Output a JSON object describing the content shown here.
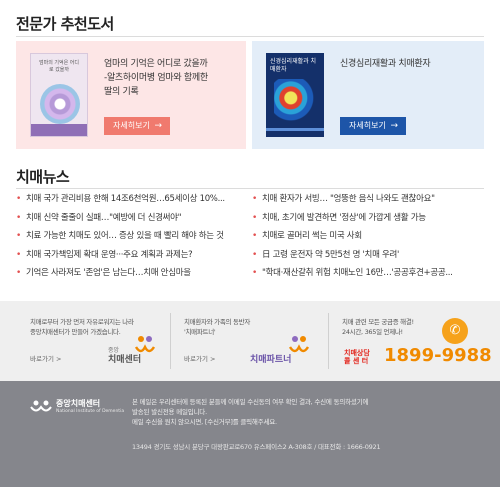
{
  "books": {
    "title": "전문가 추천도서",
    "items": [
      {
        "cover_text": "엄마의 기억은 어디로 갔을까",
        "text_line1": "엄마의 기억은 어디로 갔을까",
        "text_line2": "-알츠하이머병 엄마와 함께한",
        "text_line3": "딸의 기록",
        "button": "자세히보기"
      },
      {
        "cover_text": "신경심리재활과 치매환자",
        "text_line1": "신경심리재활과 치매환자",
        "button": "자세히보기"
      }
    ]
  },
  "news": {
    "title": "치매뉴스",
    "left": [
      "치매 국가 관리비용 한해 14조6천억원…65세이상 10%...",
      "치매 신약 줄줄이 실패…\"예방에 더 신경써야\"",
      "치료 가능한 치매도 있어… 증상 있을 때 빨리 해야 하는 것",
      "치매 국가책임제 확대 운영···주요 계획과 과제는?",
      "기억은 사라져도 '존엄'은 남는다…치매 안심마을"
    ],
    "right": [
      "치매 환자가 서빙… \"엉뚱한 음식 나와도 괜찮아요\"",
      "치매, 초기에 발견하면 '정상'에 가깝게 생활 가능",
      "치매로 골머리 썩는 미국 사회",
      "日 고령 운전자 약 5만5천 명 '치매 우려'",
      "\"학대·재산갈취 위험 치매노인 16만…'공공후견+공공..."
    ]
  },
  "promo": {
    "col1": {
      "desc1": "치매로부터 가장 먼저 자유로워지는 나라",
      "desc2": "중앙치매센터가 만들어 가겠습니다.",
      "more": "바로가기 >",
      "logo_small": "중앙",
      "logo": "치매센터"
    },
    "col2": {
      "desc1": "치매환자와 가족의 동반자",
      "desc2": "'치매파트너'",
      "more": "바로가기 >",
      "logo": "치매파트너"
    },
    "col3": {
      "desc1": "치매 관련 모든 궁금증 해결!",
      "desc2": "24시간, 365일 언제나!",
      "call_label1": "치매상담",
      "call_label2": "콜 센 터",
      "number": "1899-9988"
    }
  },
  "footer": {
    "org": "중앙치매센터",
    "org_en": "National Institute of Dementia",
    "line1": "본 메일은 우리센터에 등록된 분들께 이메일 수신동의 여부 확인 결과, 수신에 동의하셨기에",
    "line2": "발송된 발신전용 메일입니다.",
    "line3": "메일 수신을 원치 않으시면, [수신거부]를 클릭해주세요.",
    "address": "13494 경기도 성남시 분당구 대왕판교로670 유스페이스2 A-308호 / 대표전화 : 1666-0921"
  },
  "colors": {
    "pink_card": "#fde6e6",
    "blue_card": "#e3edf8",
    "pink_button": "#f07a6e",
    "blue_button": "#1d55a8",
    "bullet": "#e35050",
    "orange": "#f08a00",
    "footer_bg": "#85868c"
  },
  "icons": [
    "phone-icon",
    "center-logo-icon",
    "partner-logo-icon",
    "arrow-right-icon"
  ]
}
